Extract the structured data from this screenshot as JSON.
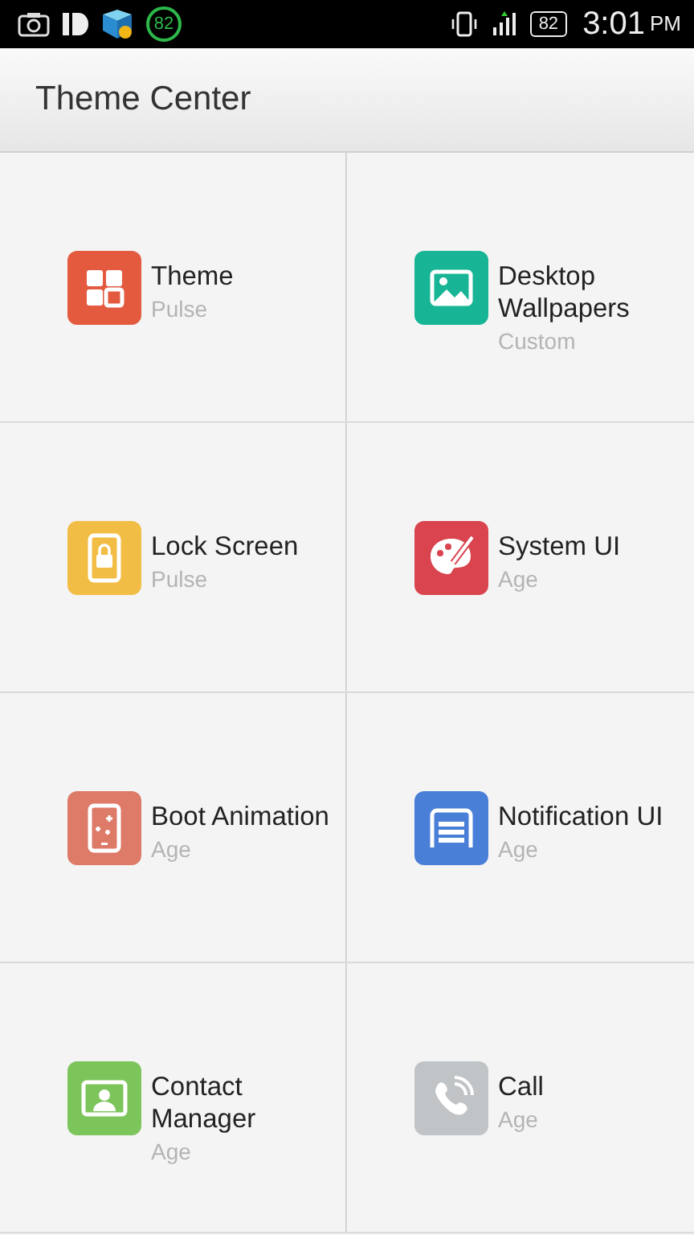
{
  "status_bar": {
    "badge": "82",
    "battery": "82",
    "time": "3:01",
    "ampm": "PM"
  },
  "header": {
    "title": "Theme Center"
  },
  "items": [
    {
      "kind": "tiles",
      "title": "Theme",
      "subtitle": "Pulse",
      "color": "#e35a3f"
    },
    {
      "kind": "image",
      "title": "Desktop\nWallpapers",
      "subtitle": "Custom",
      "color": "#17b595"
    },
    {
      "kind": "lock",
      "title": "Lock Screen",
      "subtitle": "Pulse",
      "color": "#f2bd45"
    },
    {
      "kind": "palette",
      "title": "System UI",
      "subtitle": "Age",
      "color": "#d9444f"
    },
    {
      "kind": "phone",
      "title": "Boot Animation",
      "subtitle": "Age",
      "color": "#dd7a68"
    },
    {
      "kind": "panel",
      "title": "Notification UI",
      "subtitle": "Age",
      "color": "#4a7fd8"
    },
    {
      "kind": "contact",
      "title": "Contact\nManager",
      "subtitle": "Age",
      "color": "#7cc55a"
    },
    {
      "kind": "call",
      "title": "Call",
      "subtitle": "Age",
      "color": "#c0c4c6"
    }
  ]
}
